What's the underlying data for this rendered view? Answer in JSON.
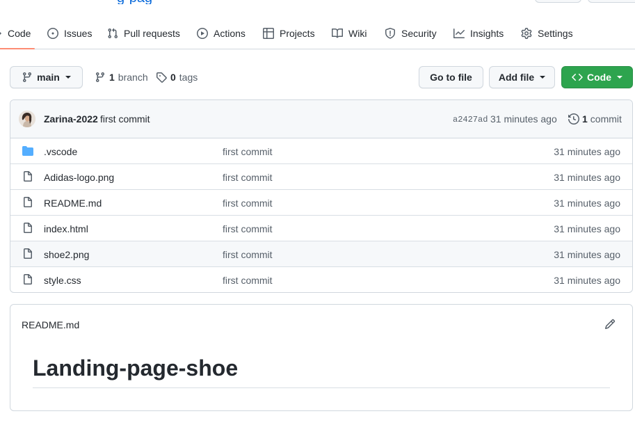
{
  "repo_header": {
    "name_fragment": "g-pag"
  },
  "nav": {
    "tabs": [
      {
        "label": "Code",
        "icon": "code-icon",
        "active": true
      },
      {
        "label": "Issues",
        "icon": "issue-opened-icon"
      },
      {
        "label": "Pull requests",
        "icon": "git-pull-request-icon"
      },
      {
        "label": "Actions",
        "icon": "play-icon"
      },
      {
        "label": "Projects",
        "icon": "table-icon"
      },
      {
        "label": "Wiki",
        "icon": "book-icon"
      },
      {
        "label": "Security",
        "icon": "shield-icon"
      },
      {
        "label": "Insights",
        "icon": "graph-icon"
      },
      {
        "label": "Settings",
        "icon": "gear-icon"
      }
    ]
  },
  "toolbar": {
    "branch_label": "main",
    "branch_count": "1",
    "branch_word": "branch",
    "tag_count": "0",
    "tag_word": "tags",
    "go_to_file": "Go to file",
    "add_file": "Add file",
    "code_button": "Code",
    "code_button_color": "#2da44e"
  },
  "latest_commit": {
    "author": "Zarina-2022",
    "message": "first commit",
    "sha": "a2427ad",
    "time": "31 minutes ago",
    "count": "1",
    "count_word": "commit"
  },
  "files": [
    {
      "name": ".vscode",
      "type": "folder",
      "message": "first commit",
      "time": "31 minutes ago"
    },
    {
      "name": "Adidas-logo.png",
      "type": "file",
      "message": "first commit",
      "time": "31 minutes ago"
    },
    {
      "name": "README.md",
      "type": "file",
      "message": "first commit",
      "time": "31 minutes ago"
    },
    {
      "name": "index.html",
      "type": "file",
      "message": "first commit",
      "time": "31 minutes ago"
    },
    {
      "name": "shoe2.png",
      "type": "file",
      "message": "first commit",
      "time": "31 minutes ago"
    },
    {
      "name": "style.css",
      "type": "file",
      "message": "first commit",
      "time": "31 minutes ago"
    }
  ],
  "readme": {
    "filename": "README.md",
    "heading": "Landing-page-shoe"
  },
  "colors": {
    "folder_icon": "#54aeff",
    "active_tab_underline": "#fd8c73",
    "link": "#0969da"
  }
}
